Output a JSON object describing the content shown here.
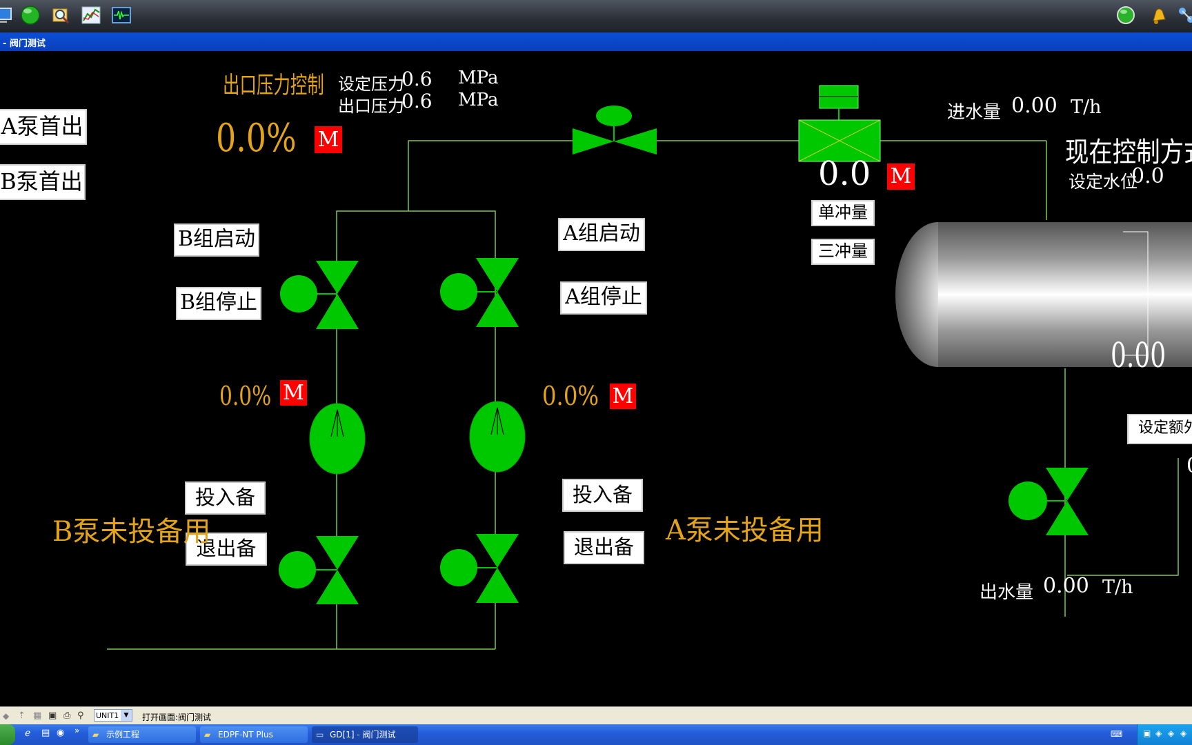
{
  "window": {
    "title": "- 阀门测试"
  },
  "toolbar": {
    "icons": [
      "monitor-icon",
      "green-ball-icon",
      "magnifier-icon",
      "trend-chart-icon",
      "oscilloscope-icon"
    ],
    "right_icons": [
      "status-green-icon",
      "bell-icon",
      "network-icon"
    ]
  },
  "pressure": {
    "title": "出口压力控制",
    "set_label": "设定压力",
    "set_value": "0.6",
    "set_unit": "MPa",
    "out_label": "出口压力",
    "out_value": "0.6",
    "out_unit": "MPa",
    "percent": "0.0%",
    "mode": "M"
  },
  "buttons": {
    "a_pump_first": "A泵首出",
    "b_pump_first": "B泵首出",
    "b_group_start": "B组启动",
    "b_group_stop": "B组停止",
    "a_group_start": "A组启动",
    "a_group_stop": "A组停止",
    "b_standby_in": "投入备用",
    "b_standby_out": "退出备用",
    "a_standby_in": "投入备用",
    "a_standby_out": "退出备用",
    "single_impulse": "单冲量",
    "triple_impulse": "三冲量",
    "extra_setting": "设定额外的出"
  },
  "pumps": {
    "b_percent": "0.0%",
    "b_mode": "M",
    "a_percent": "0.0%",
    "a_mode": "M",
    "b_standby_status": "B泵未投备用",
    "a_standby_status": "A泵未投备用"
  },
  "valve_motor_label": "M",
  "feed": {
    "label": "进水量",
    "value": "0.00",
    "unit": "T/h",
    "valve_value": "0.0",
    "valve_mode": "M"
  },
  "control": {
    "mode_label": "现在控制方式为:",
    "level_label": "设定水位",
    "level_value": "0.0"
  },
  "drum": {
    "level_value": "0.00",
    "side_value": "0"
  },
  "outflow": {
    "label": "出水量",
    "value": "0.00",
    "unit": "T/h"
  },
  "statusbar": {
    "unit_select": "UNIT1",
    "message": "打开画面:阀门测试"
  },
  "taskbar": {
    "items": [
      "示例工程",
      "EDPF-NT Plus",
      "GD[1] - 阀门测试"
    ]
  },
  "colors": {
    "green": "#00c800",
    "orange": "#e4a41a",
    "pipe": "#7ec850",
    "red": "#ff0000"
  }
}
